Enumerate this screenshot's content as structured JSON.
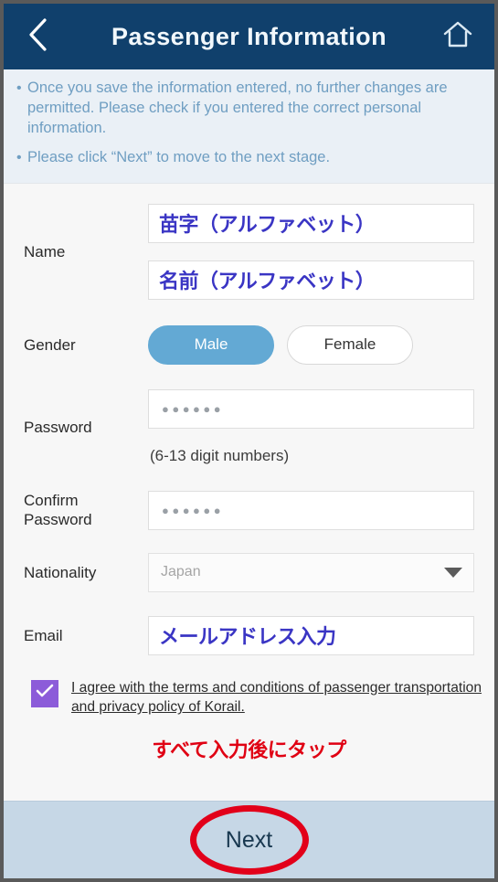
{
  "header": {
    "title": "Passenger Information",
    "back_icon": "chevron-left-icon",
    "home_icon": "home-icon"
  },
  "notice": {
    "bullet": "•",
    "lines": [
      "Once you save the information entered, no further changes are permitted. Please check if you entered the correct personal information.",
      "Please click “Next” to move to the next stage."
    ]
  },
  "form": {
    "name": {
      "label": "Name",
      "surname_value": "苗字（アルファベット）",
      "givenname_value": "名前（アルファベット）"
    },
    "gender": {
      "label": "Gender",
      "options": [
        "Male",
        "Female"
      ],
      "selected": "Male"
    },
    "password": {
      "label": "Password",
      "value_mask": "●●●●●●",
      "hint": "(6-13 digit numbers)"
    },
    "confirm_password": {
      "label": "Confirm Password",
      "label_line1": "Confirm",
      "label_line2": "Password",
      "value_mask": "●●●●●●"
    },
    "nationality": {
      "label": "Nationality",
      "selected": "Japan",
      "caret_icon": "chevron-down-icon"
    },
    "email": {
      "label": "Email",
      "value": "メールアドレス入力"
    },
    "agreement": {
      "checked": true,
      "check_icon": "checkmark-icon",
      "text": "I agree with the terms and conditions of passenger transportation and privacy policy of Korail."
    }
  },
  "annotation": {
    "text": "すべて入力後にタップ"
  },
  "footer": {
    "next_label": "Next",
    "highlight_shape": "red-ellipse-annotation"
  },
  "colors": {
    "header_bg": "#10406c",
    "notice_bg": "#eaf0f6",
    "notice_text": "#6f9ec2",
    "jp_value": "#3a35c4",
    "pill_on": "#63a9d4",
    "checkbox": "#8c5cd9",
    "annotation_red": "#e00013",
    "footer_bg": "#c6d7e6",
    "next_text": "#17374f"
  }
}
